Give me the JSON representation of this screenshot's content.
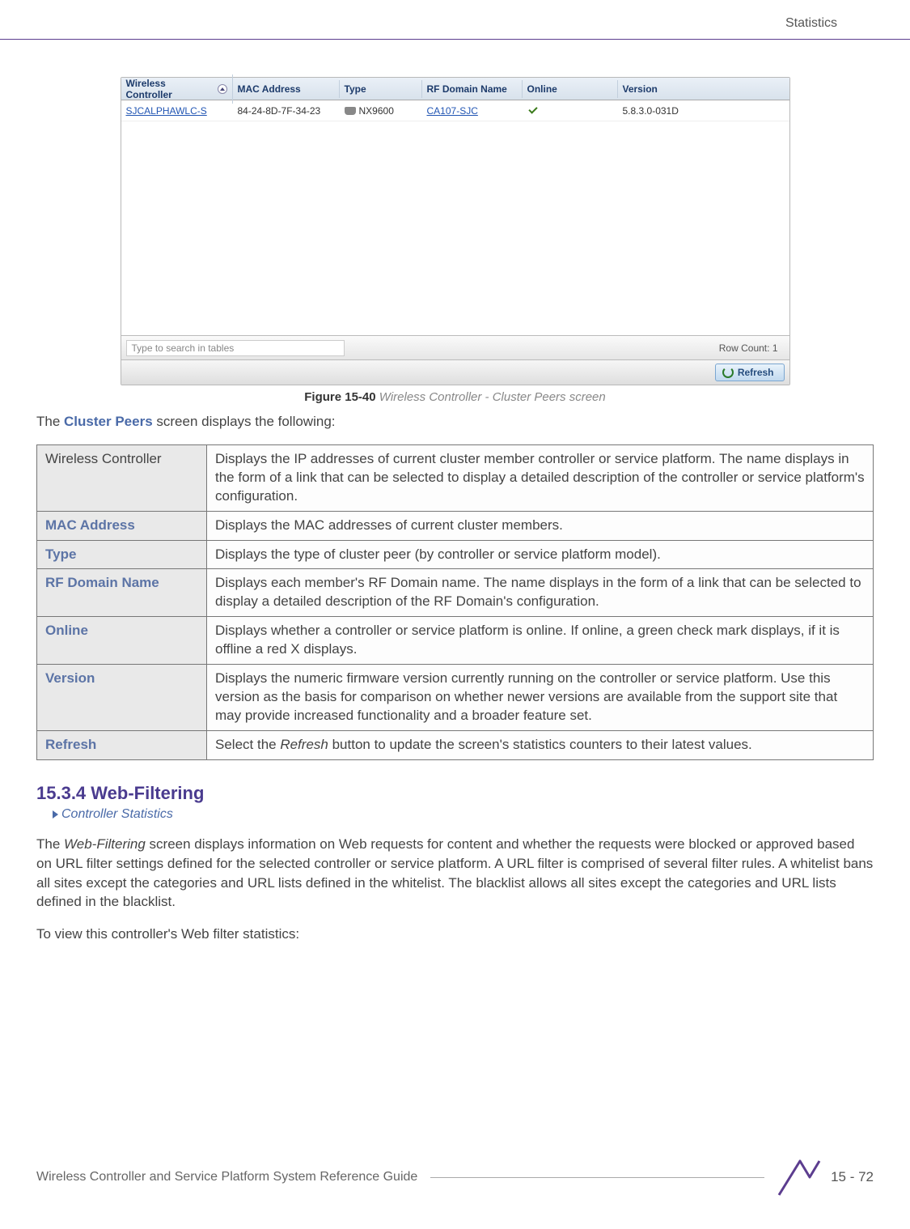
{
  "header": {
    "section": "Statistics"
  },
  "figure": {
    "label": "Figure 15-40",
    "title": "Wireless Controller - Cluster Peers screen",
    "columns": {
      "wc": "Wireless Controller",
      "mac": "MAC Address",
      "type": "Type",
      "rf": "RF Domain Name",
      "online": "Online",
      "version": "Version"
    },
    "row": {
      "wc": "SJCALPHAWLC-S",
      "mac": "84-24-8D-7F-34-23",
      "type": "NX9600",
      "rf": "CA107-SJC",
      "version": "5.8.3.0-031D"
    },
    "search_placeholder": "Type to search in tables",
    "row_count_label": "Row Count:",
    "row_count_value": "1",
    "refresh_label": "Refresh"
  },
  "intro": {
    "prefix": "The ",
    "emph": "Cluster Peers",
    "suffix": " screen displays the following:"
  },
  "desc_rows": [
    {
      "label": "Wireless Controller",
      "plain": true,
      "desc": "Displays the IP addresses of current cluster member controller or service platform. The name displays in the form of a link that can be selected to display a detailed description of the controller or service platform's configuration."
    },
    {
      "label": "MAC Address",
      "desc": "Displays the MAC addresses of current cluster members."
    },
    {
      "label": "Type",
      "desc": "Displays the type of cluster peer (by controller or service platform model)."
    },
    {
      "label": "RF Domain Name",
      "desc": "Displays each member's RF Domain name. The name displays in the form of a link that can be selected to display a detailed description of the RF Domain's configuration."
    },
    {
      "label": "Online",
      "desc": "Displays whether a controller or service platform is online. If online, a green check mark displays, if it is offline a red X displays."
    },
    {
      "label": "Version",
      "desc": "Displays the numeric firmware version currently running on the controller or service platform. Use this version as the basis for comparison on whether newer versions are available from the support site that may provide increased functionality and a broader feature set."
    },
    {
      "label": "Refresh",
      "desc_prefix": "Select the ",
      "desc_ital": "Refresh",
      "desc_suffix": " button to update the screen's statistics counters to their latest values."
    }
  ],
  "section": {
    "heading": "15.3.4 Web-Filtering",
    "breadcrumb": "Controller Statistics"
  },
  "para1": {
    "prefix": "The ",
    "ital": "Web-Filtering",
    "suffix": " screen displays information on Web requests for content and whether the requests were blocked or approved based on URL filter settings defined for the selected controller or service platform. A URL filter is comprised of several filter rules. A whitelist bans all sites except the categories and URL lists defined in the whitelist. The blacklist allows all sites except the categories and URL lists defined in the blacklist."
  },
  "para2": "To view this controller's Web filter statistics:",
  "footer": {
    "title": "Wireless Controller and Service Platform System Reference Guide",
    "page": "15 - 72"
  }
}
